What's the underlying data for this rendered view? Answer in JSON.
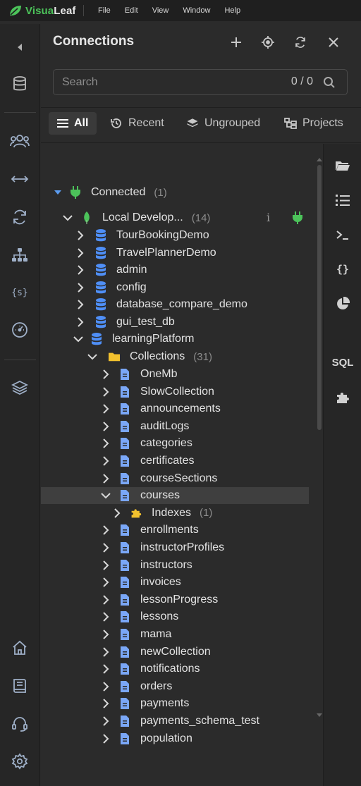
{
  "app": {
    "name_part1": "Visua",
    "name_part2": "Leaf"
  },
  "menu": [
    "File",
    "Edit",
    "View",
    "Window",
    "Help"
  ],
  "leftbar": {
    "icons": [
      "collapse-left-icon",
      "database-icon",
      "users-icon",
      "compare-arrows-icon",
      "sync-icon",
      "hierarchy-icon",
      "variables-icon",
      "gauge-icon",
      "layers-icon",
      "home-icon",
      "book-icon",
      "support-headset-icon",
      "settings-gear-icon"
    ]
  },
  "panel": {
    "title": "Connections",
    "search_placeholder": "Search",
    "search_count": "0 / 0",
    "tabs": [
      {
        "label": "All",
        "icon": "list-icon",
        "active": true
      },
      {
        "label": "Recent",
        "icon": "history-icon",
        "active": false
      },
      {
        "label": "Ungrouped",
        "icon": "stack-icon",
        "active": false
      },
      {
        "label": "Projects",
        "icon": "projects-icon",
        "active": false
      }
    ]
  },
  "tree": {
    "connected": {
      "label": "Connected",
      "count": "(1)"
    },
    "connection": {
      "label": "Local Develop...",
      "count": "(14)",
      "info": "i"
    },
    "databases": [
      "TourBookingDemo",
      "TravelPlannerDemo",
      "admin",
      "config",
      "database_compare_demo",
      "gui_test_db",
      "learningPlatform"
    ],
    "collections_node": {
      "label": "Collections",
      "count": "(31)"
    },
    "collections": [
      "OneMb",
      "SlowCollection",
      "announcements",
      "auditLogs",
      "categories",
      "certificates",
      "courseSections",
      "courses",
      "enrollments",
      "instructorProfiles",
      "instructors",
      "invoices",
      "lessonProgress",
      "lessons",
      "mama",
      "newCollection",
      "notifications",
      "orders",
      "payments",
      "payments_schema_test",
      "population"
    ],
    "indexes": {
      "label": "Indexes",
      "count": "(1)"
    }
  },
  "rightbar": {
    "sql_label": "SQL"
  },
  "colors": {
    "accent_green": "#4cc35a",
    "db_blue": "#4f8ff7",
    "doc_blue": "#7aa7f7",
    "folder_yellow": "#f2c12e"
  }
}
